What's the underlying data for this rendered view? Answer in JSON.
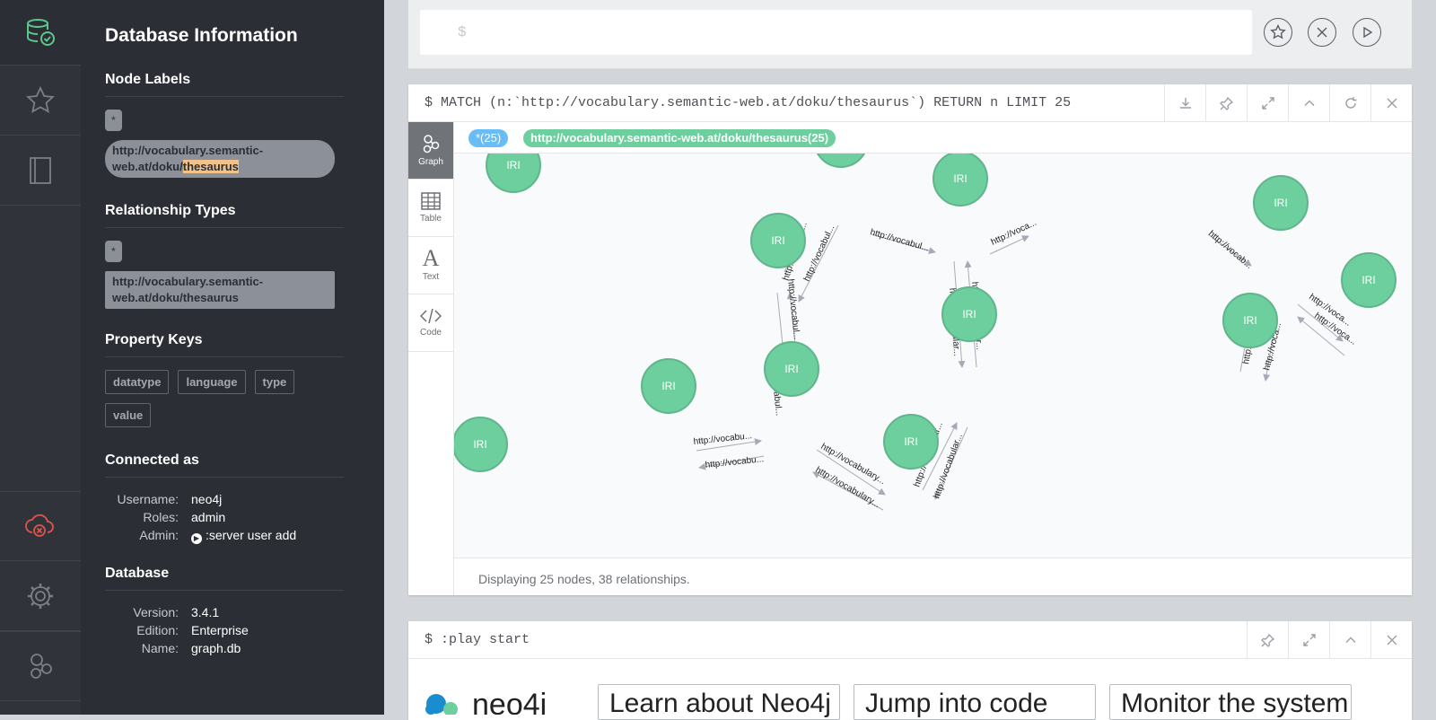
{
  "nav": {
    "items": [
      "database-icon",
      "favorites-icon",
      "documents-icon",
      "connection-error-icon",
      "settings-icon",
      "about-icon"
    ]
  },
  "drawer": {
    "title": "Database Information",
    "node_labels": {
      "heading": "Node Labels",
      "all": "*",
      "label_prefix": "http://vocabulary.semantic-web.at/doku/",
      "label_highlight": "thesaurus"
    },
    "relationship_types": {
      "heading": "Relationship Types",
      "all": "*",
      "type": "http://vocabulary.semantic-web.at/doku/thesaurus"
    },
    "property_keys": {
      "heading": "Property Keys",
      "keys": [
        "datatype",
        "language",
        "type",
        "value"
      ]
    },
    "connected_as": {
      "heading": "Connected as",
      "username_label": "Username:",
      "username": "neo4j",
      "roles_label": "Roles:",
      "roles": "admin",
      "admin_label": "Admin:",
      "admin_cmd": ":server user add"
    },
    "database": {
      "heading": "Database",
      "version_label": "Version:",
      "version": "3.4.1",
      "edition_label": "Edition:",
      "edition": "Enterprise",
      "name_label": "Name:",
      "name": "graph.db"
    }
  },
  "editor": {
    "prompt": "$"
  },
  "result_frame": {
    "query": "$ MATCH (n:`http://vocabulary.semantic-web.at/doku/thesaurus`) RETURN n LIMIT 25",
    "tabs": [
      "Graph",
      "Table",
      "Text",
      "Code"
    ],
    "legend_all": "*(25)",
    "legend_label": "http://vocabulary.semantic-web.at/doku/thesaurus(25)",
    "node_caption": "IRI",
    "edge_caption_a": "http://vocabu...",
    "edge_caption_b": "http://vocabul...",
    "edge_caption_c": "http://vocabulary...",
    "edge_caption_d": "http://vocabular...",
    "edge_caption_e": "http://vocabu...",
    "edge_caption_f": "http://voca...",
    "edge_caption_g": "http://vocab...",
    "edge_caption_h": "http://vocabul...",
    "status": "Displaying 25 nodes, 38 relationships.",
    "colors": {
      "node_fill": "#6dce9e",
      "node_stroke": "#60b58b",
      "legend_all": "#68bdf6",
      "legend_label": "#6dce9e"
    }
  },
  "play_frame": {
    "query": "$ :play start",
    "brand": "neo4j",
    "tiles": [
      "Learn about Neo4j",
      "Jump into code",
      "Monitor the system"
    ]
  }
}
